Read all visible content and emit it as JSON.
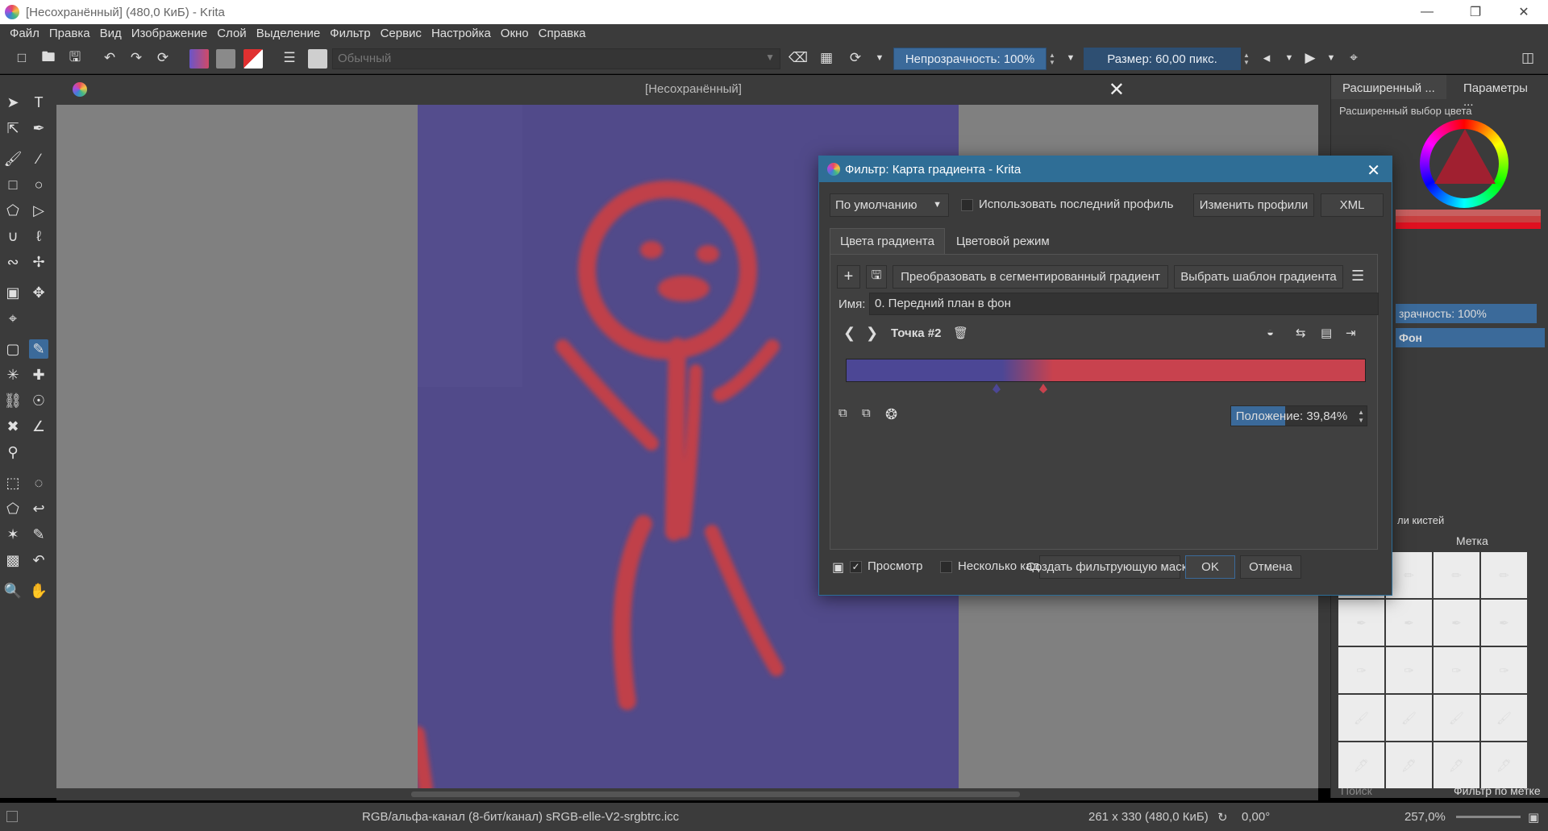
{
  "window": {
    "title": "[Несохранённый]  (480,0 КиБ)  - Krita",
    "minimize": "—",
    "maximize": "❐",
    "close": "✕"
  },
  "menu": [
    "Файл",
    "Правка",
    "Вид",
    "Изображение",
    "Слой",
    "Выделение",
    "Фильтр",
    "Сервис",
    "Настройка",
    "Окно",
    "Справка"
  ],
  "toolbar": {
    "blend_mode": "Обычный",
    "opacity": "Непрозрачность: 100%",
    "size": "Размер: 60,00 пикс."
  },
  "document": {
    "tab_title": "[Несохранённый]",
    "background_color": "#514a8a",
    "stroke_color": "#c0404a"
  },
  "dock": {
    "tab_advanced": "Расширенный ...",
    "tab_params": "Параметры ...",
    "advanced_color_title": "Расширенный выбор цвета",
    "layer_opacity": "зрачность:  100%",
    "layer_name": "Фон",
    "brush_presets_title": "ли кистей",
    "tag_label": "Метка",
    "search_placeholder": "Поиск",
    "filter_by_tag": "Фильтр по метке"
  },
  "status": {
    "color_space": "RGB/альфа-канал (8-бит/канал)  sRGB-elle-V2-srgbtrc.icc",
    "dimensions": "261 x 330 (480,0 КиБ)",
    "rotation": "0,00°",
    "zoom": "257,0%"
  },
  "dialog": {
    "title": "Фильтр: Карта градиента - Krita",
    "profile_combo": "По умолчанию",
    "use_last_profile": "Использовать последний профиль",
    "edit_profiles": "Изменить профили",
    "xml": "XML",
    "tabs": [
      "Цвета градиента",
      "Цветовой режим"
    ],
    "convert_button": "Преобразовать в сегментированный градиент",
    "choose_template": "Выбрать шаблон градиента",
    "name_label": "Имя:",
    "name_value": "0. Передний план в фон",
    "stop_label": "Точка #2",
    "position": "Положение: 39,84%",
    "position_value": 0.3984,
    "gradient": {
      "stops": [
        {
          "offset": 0.0,
          "color": "#4c4795"
        },
        {
          "offset": 0.3,
          "color": "#4c4795"
        },
        {
          "offset": 0.3984,
          "color": "#c8424e"
        },
        {
          "offset": 1.0,
          "color": "#c8424e"
        }
      ]
    },
    "preview": "Просмотр",
    "multiple_frames": "Несколько кадров",
    "create_mask": "Создать фильтрующую маску",
    "ok": "OK",
    "cancel": "Отмена"
  }
}
